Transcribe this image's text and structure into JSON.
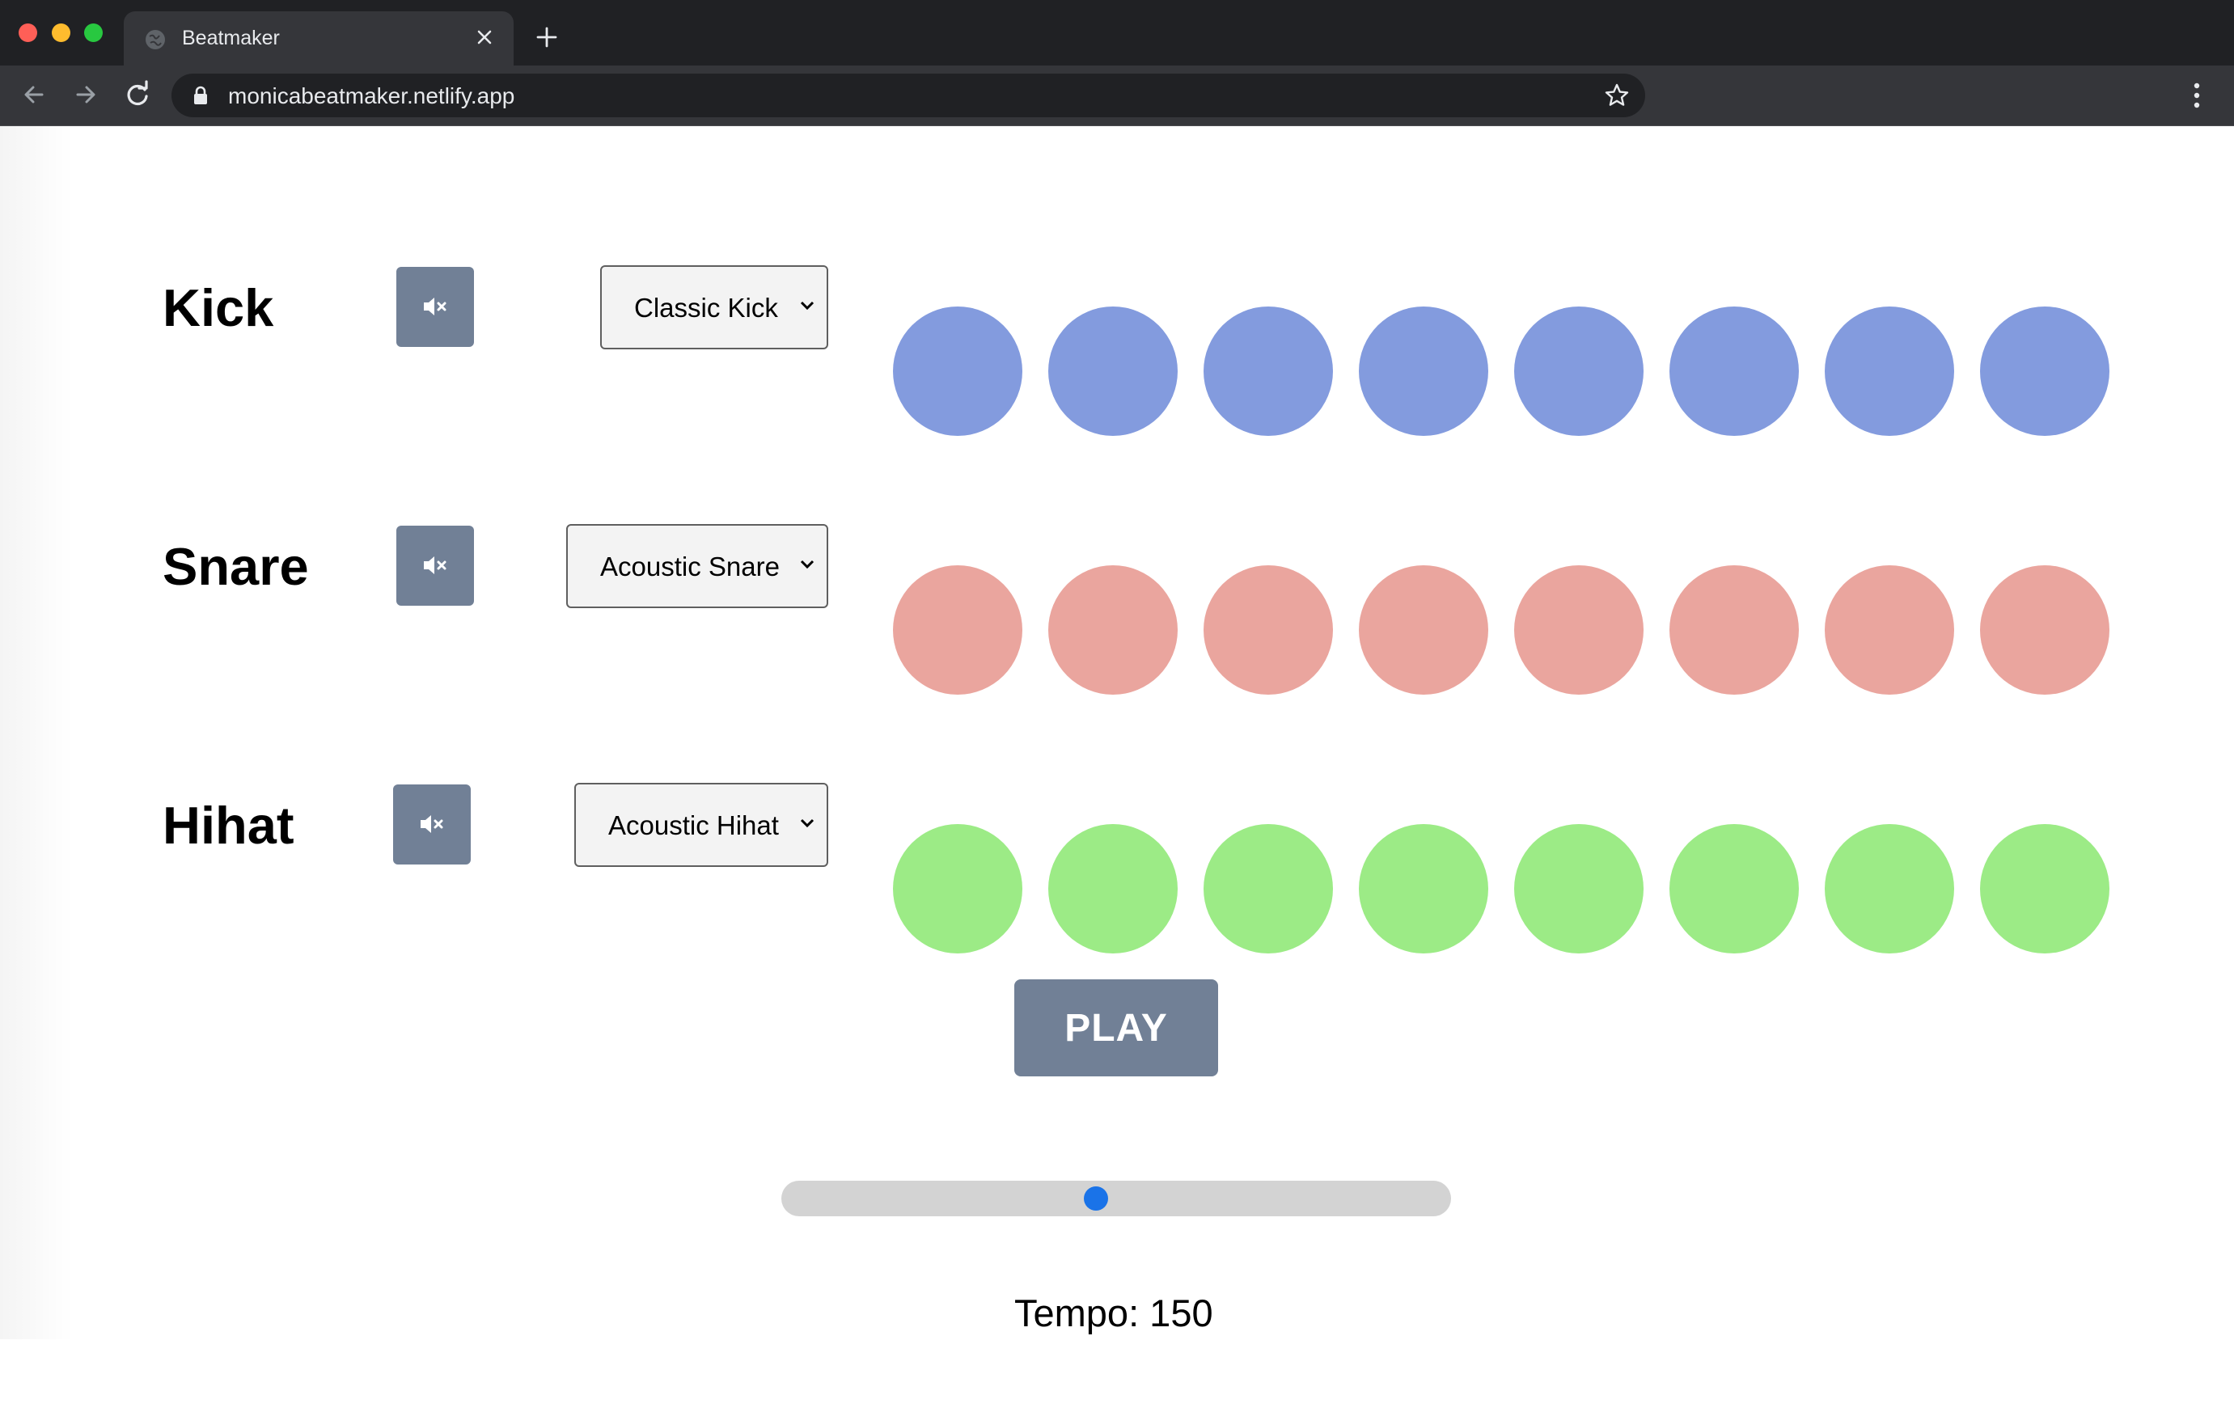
{
  "browser": {
    "tab_title": "Beatmaker",
    "url": "monicabeatmaker.netlify.app"
  },
  "tracks": [
    {
      "label": "Kick",
      "sound": "Classic Kick",
      "pad_color": "#839bde",
      "pads": 8
    },
    {
      "label": "Snare",
      "sound": "Acoustic Snare",
      "pad_color": "#eaa59e",
      "pads": 8
    },
    {
      "label": "Hihat",
      "sound": "Acoustic Hihat",
      "pad_color": "#9ceb86",
      "pads": 8
    }
  ],
  "controls": {
    "play_label": "PLAY",
    "tempo_text": "Tempo: 150",
    "tempo_value": 150,
    "tempo_slider_fraction": 0.47,
    "button_color": "#718096"
  },
  "icons": {
    "mute": "volume-mute-icon",
    "back": "back-arrow-icon",
    "forward": "forward-arrow-icon",
    "reload": "reload-icon",
    "lock": "lock-icon",
    "star": "star-icon",
    "menu": "kebab-menu-icon"
  }
}
